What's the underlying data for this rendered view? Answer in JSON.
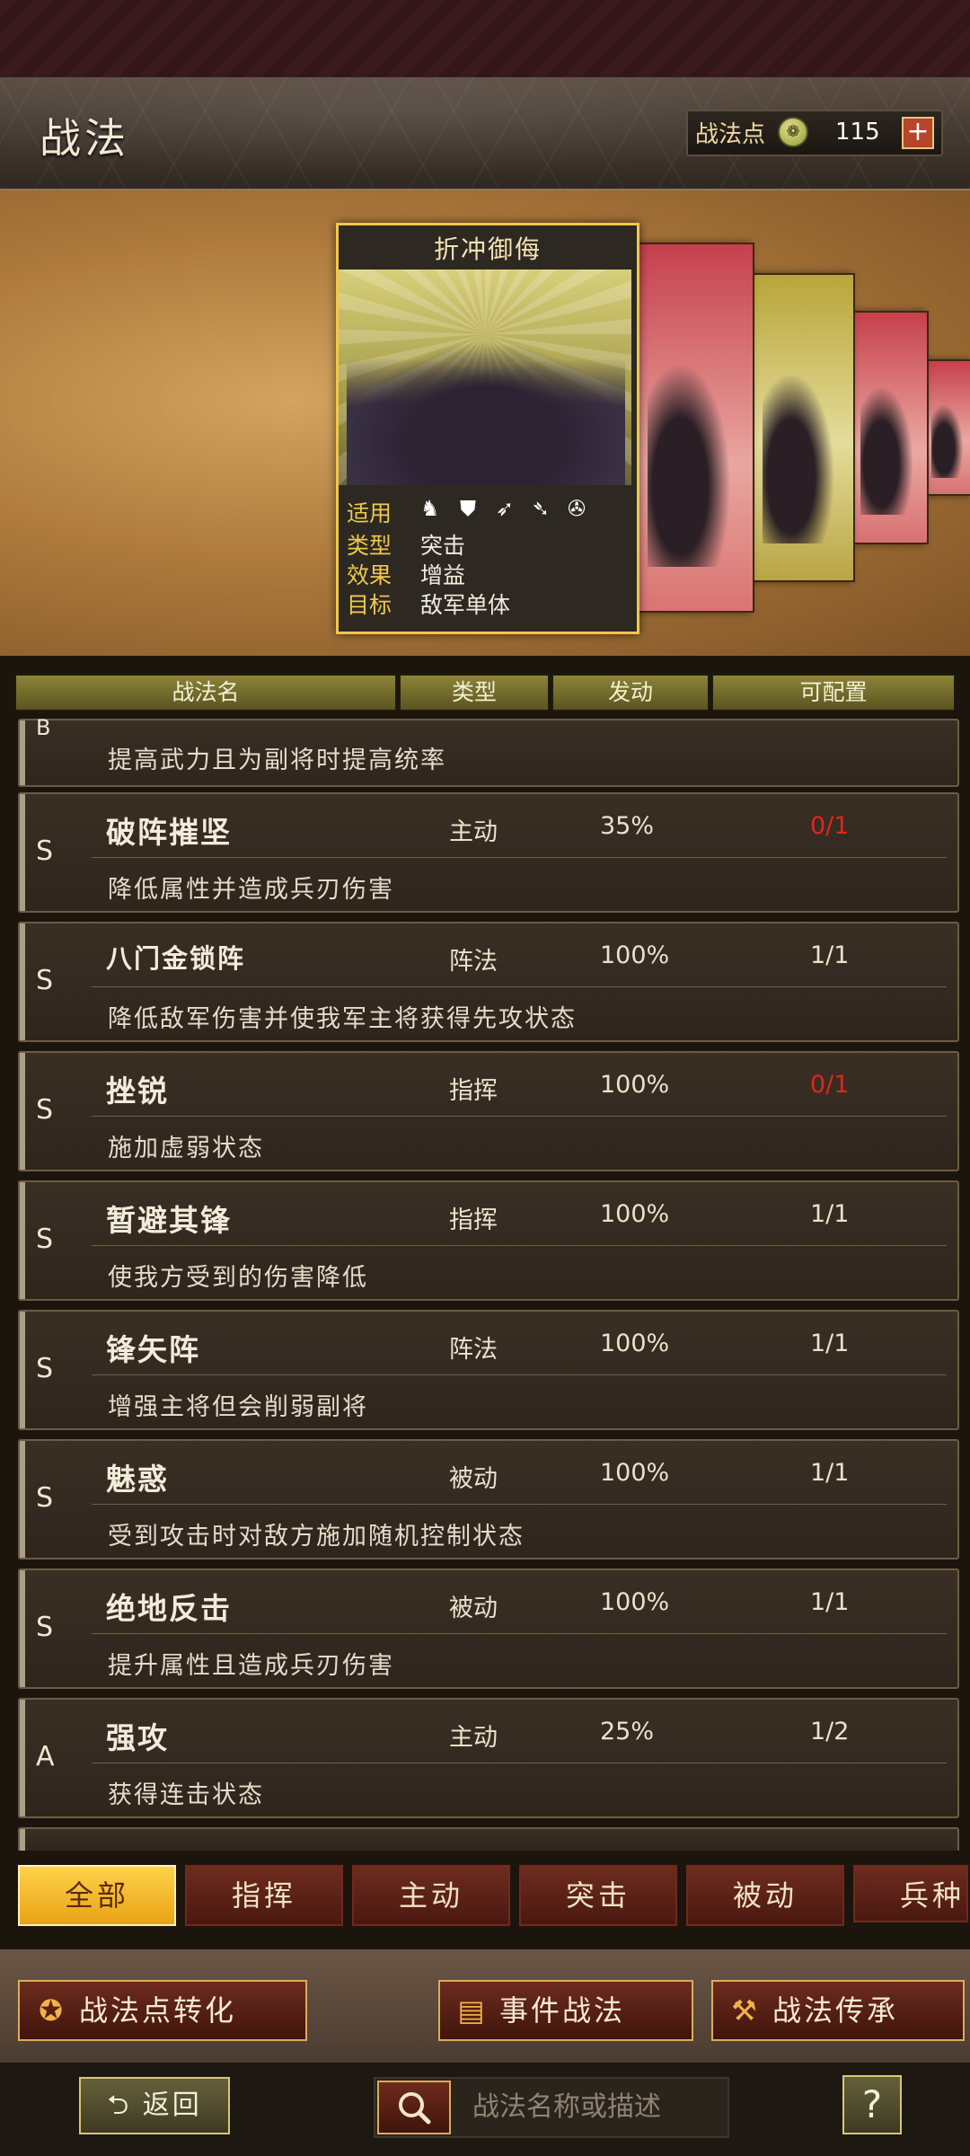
{
  "header": {
    "title": "战法",
    "points_label": "战法点",
    "points_value": "115",
    "add_symbol": "+"
  },
  "featured": {
    "name": "折冲御侮",
    "applicable_label": "适用",
    "type_label": "类型",
    "type_value": "突击",
    "effect_label": "效果",
    "effect_value": "增益",
    "target_label": "目标",
    "target_value": "敌军单体",
    "unit_icons": [
      "cavalry-icon",
      "shield-icon",
      "bow-icon",
      "spear-icon",
      "wheel-icon"
    ]
  },
  "table_headers": [
    "战法名",
    "类型",
    "发动",
    "可配置"
  ],
  "partial_top_row": {
    "grade": "B",
    "description": "提高武力且为副将时提高统率"
  },
  "rows": [
    {
      "grade": "S",
      "name": "破阵摧坚",
      "type": "主动",
      "rate": "35%",
      "config": "0/1",
      "config_alert": true,
      "description": "降低属性并造成兵刃伤害"
    },
    {
      "grade": "S",
      "name": "八门金锁阵",
      "type": "阵法",
      "rate": "100%",
      "config": "1/1",
      "config_alert": false,
      "description": "降低敌军伤害并使我军主将获得先攻状态"
    },
    {
      "grade": "S",
      "name": "挫锐",
      "type": "指挥",
      "rate": "100%",
      "config": "0/1",
      "config_alert": true,
      "description": "施加虚弱状态"
    },
    {
      "grade": "S",
      "name": "暂避其锋",
      "type": "指挥",
      "rate": "100%",
      "config": "1/1",
      "config_alert": false,
      "description": "使我方受到的伤害降低"
    },
    {
      "grade": "S",
      "name": "锋矢阵",
      "type": "阵法",
      "rate": "100%",
      "config": "1/1",
      "config_alert": false,
      "description": "增强主将但会削弱副将"
    },
    {
      "grade": "S",
      "name": "魅惑",
      "type": "被动",
      "rate": "100%",
      "config": "1/1",
      "config_alert": false,
      "description": "受到攻击时对敌方施加随机控制状态"
    },
    {
      "grade": "S",
      "name": "绝地反击",
      "type": "被动",
      "rate": "100%",
      "config": "1/1",
      "config_alert": false,
      "description": "提升属性且造成兵刃伤害"
    },
    {
      "grade": "A",
      "name": "强攻",
      "type": "主动",
      "rate": "25%",
      "config": "1/2",
      "config_alert": false,
      "description": "获得连击状态"
    }
  ],
  "filter_tabs": [
    "全部",
    "指挥",
    "主动",
    "突击",
    "被动",
    "兵种"
  ],
  "active_tab": "全部",
  "actions": {
    "convert": "战法点转化",
    "event": "事件战法",
    "inherit": "战法传承"
  },
  "nav": {
    "back": "返回",
    "search_placeholder": "战法名称或描述",
    "help": "?"
  },
  "colors": {
    "accent_gold": "#f0c84a",
    "alert_red": "#e0261c",
    "tab_active": "#ffd24a"
  }
}
